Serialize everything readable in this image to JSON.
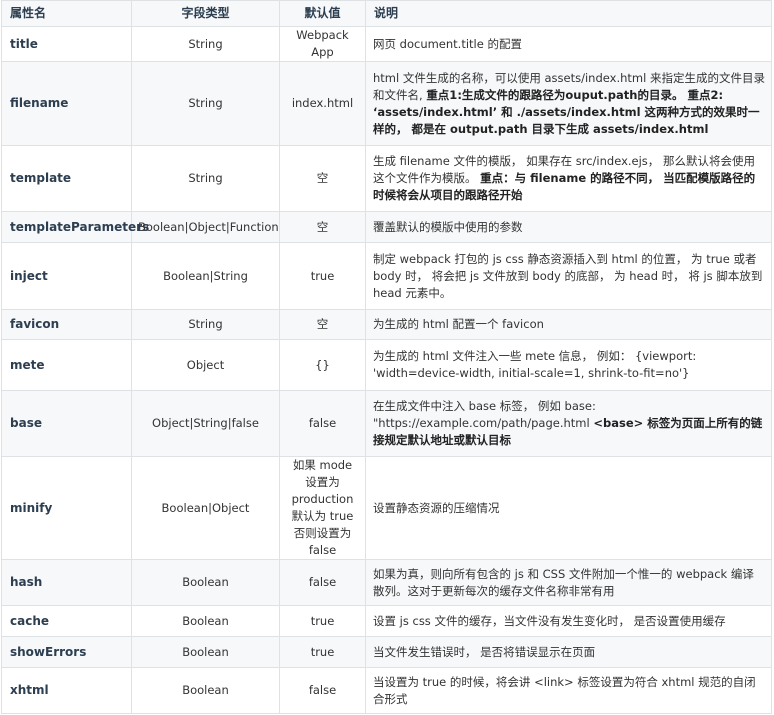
{
  "headers": [
    "属性名",
    "字段类型",
    "默认值",
    "说明"
  ],
  "rows": [
    {
      "name": "title",
      "type": "String",
      "default": "Webpack App",
      "desc": [
        {
          "t": "网页 document.title 的配置"
        }
      ]
    },
    {
      "name": "filename",
      "type": "String",
      "default": "index.html",
      "desc": [
        {
          "t": "html 文件生成的名称，可以使用 assets/index.html 来指定生成的文件目录和文件名, "
        },
        {
          "t": "重点1:生成文件的跟路径为ouput.path的目录。 重点2: ‘assets/index.html’ 和 ./assets/index.html 这两种方式的效果时一样的， 都是在 output.path 目录下生成 assets/index.html",
          "b": true
        }
      ]
    },
    {
      "name": "template",
      "type": "String",
      "default": "空",
      "desc": [
        {
          "t": "生成 filename 文件的模版， 如果存在 src/index.ejs， 那么默认将会使用这个文件作为模版。 "
        },
        {
          "t": "重点：与 filename 的路径不同， 当匹配模版路径的时候将会从项目的跟路径开始",
          "b": true
        }
      ]
    },
    {
      "name": "templateParameters",
      "type": "Boolean|Object|Function",
      "default": "空",
      "desc": [
        {
          "t": "覆盖默认的模版中使用的参数"
        }
      ]
    },
    {
      "name": "inject",
      "type": "Boolean|String",
      "default": "true",
      "desc": [
        {
          "t": "制定 webpack 打包的 js css 静态资源插入到 html 的位置， 为 true 或者 body 时， 将会把 js 文件放到 body 的底部， 为 head 时， 将 js 脚本放到 head 元素中。"
        }
      ]
    },
    {
      "name": "favicon",
      "type": "String",
      "default": "空",
      "desc": [
        {
          "t": "为生成的 html 配置一个 favicon"
        }
      ]
    },
    {
      "name": "mete",
      "type": "Object",
      "default": "{}",
      "desc": [
        {
          "t": "为生成的 html 文件注入一些 mete 信息， 例如： {viewport: 'width=device-width, initial-scale=1, shrink-to-fit=no'}"
        }
      ]
    },
    {
      "name": "base",
      "type": "Object|String|false",
      "default": "false",
      "desc": [
        {
          "t": "在生成文件中注入 base 标签， 例如 base: \"https://example.com/path/page.html "
        },
        {
          "t": "<base> 标签为页面上所有的链接规定默认地址或默认目标",
          "b": true
        }
      ]
    },
    {
      "name": "minify",
      "type": "Boolean|Object",
      "default": "如果 mode 设置为 production 默认为 true 否则设置为 false",
      "desc": [
        {
          "t": "设置静态资源的压缩情况"
        }
      ]
    },
    {
      "name": "hash",
      "type": "Boolean",
      "default": "false",
      "desc": [
        {
          "t": "如果为真，则向所有包含的 js 和 CSS 文件附加一个惟一的 webpack 编译散列。这对于更新每次的缓存文件名称非常有用"
        }
      ]
    },
    {
      "name": "cache",
      "type": "Boolean",
      "default": "true",
      "desc": [
        {
          "t": "设置 js css 文件的缓存，当文件没有发生变化时， 是否设置使用缓存"
        }
      ]
    },
    {
      "name": "showErrors",
      "type": "Boolean",
      "default": "true",
      "desc": [
        {
          "t": "当文件发生错误时， 是否将错误显示在页面"
        }
      ]
    },
    {
      "name": "xhtml",
      "type": "Boolean",
      "default": "false",
      "desc": [
        {
          "t": "当设置为 true 的时候，将会讲 <link> 标签设置为符合 xhtml 规范的自闭合形式"
        }
      ]
    }
  ]
}
